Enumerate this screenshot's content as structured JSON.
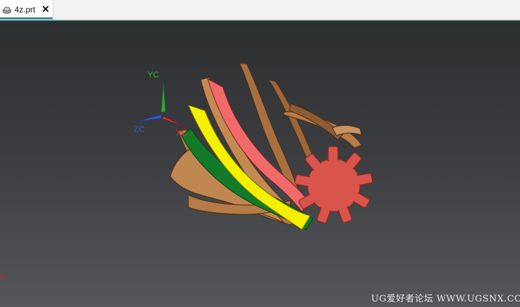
{
  "tab": {
    "label": "4z.prt",
    "close": "✕",
    "icon": "part-file-icon"
  },
  "axes": {
    "y_label": "YC",
    "z_label": "ZC",
    "x_label": "XC",
    "colors": {
      "y": "#2ea83a",
      "z": "#2f5bd6",
      "x": "#d83a3a"
    }
  },
  "corner_mark": "X",
  "watermark": "UG爱好者论坛 WWW.UGSNX.COM",
  "model": {
    "name": "helical gear blades",
    "colors": {
      "blade": "#b77c48",
      "blade_dark": "#7d5230",
      "highlight_red": "#f06a6a",
      "highlight_yellow": "#f4f000",
      "highlight_green": "#137a2a",
      "gear": "#d9554b"
    }
  }
}
